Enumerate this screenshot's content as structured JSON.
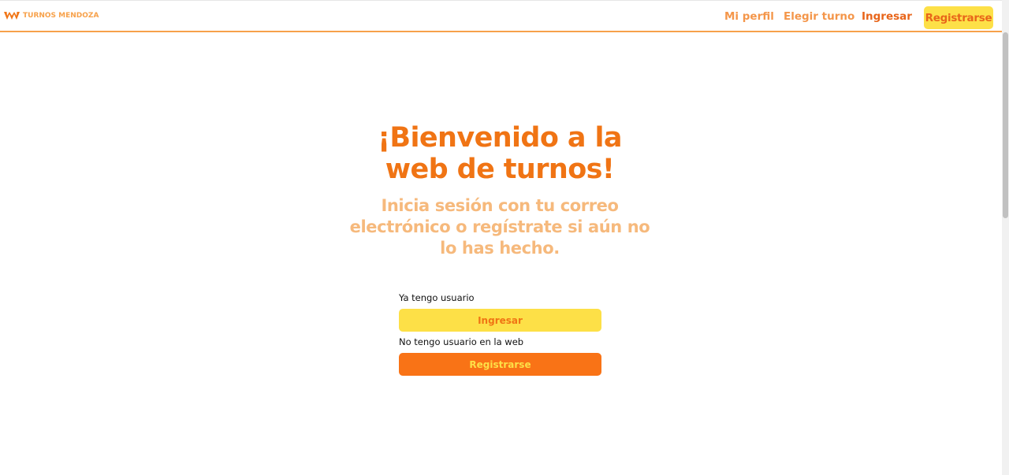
{
  "header": {
    "brand": {
      "logo_icon": "wm-logo-icon",
      "text": "TURNOS MENDOZA"
    },
    "nav": {
      "profile": "Mi perfil",
      "choose_turn": "Elegir turno",
      "login": "Ingresar",
      "register": "Registrarse"
    }
  },
  "hero": {
    "title": "¡Bienvenido a la web de turnos!",
    "subtitle": "Inicia sesión con tu correo electrónico o regístrate si aún no lo has hecho."
  },
  "form": {
    "existing_user_label": "Ya tengo usuario",
    "login_button": "Ingresar",
    "new_user_label": "No tengo usuario en la web",
    "register_button": "Registrarse"
  },
  "colors": {
    "primary_orange": "#f07414",
    "light_orange": "#f6b97c",
    "yellow": "#fde047",
    "button_orange": "#f97316"
  }
}
